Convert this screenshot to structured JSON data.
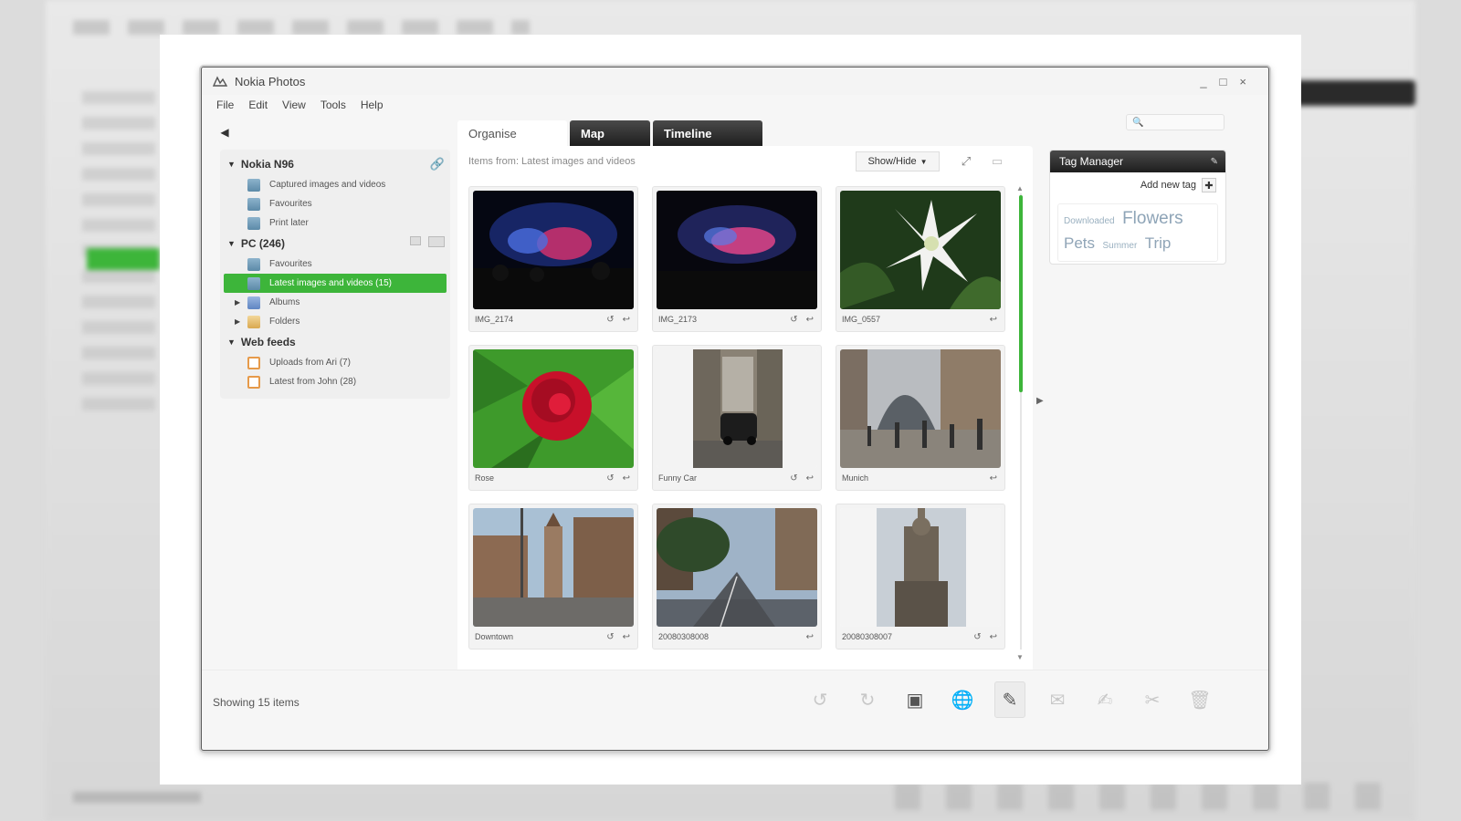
{
  "window": {
    "title": "Nokia Photos",
    "controls": [
      "_",
      "□",
      "×"
    ]
  },
  "menu": [
    "File",
    "Edit",
    "View",
    "Tools",
    "Help"
  ],
  "sidebar": {
    "sections": [
      {
        "label": "Nokia N96",
        "items": [
          {
            "label": "Captured images and videos",
            "icon": "photo-album-icon"
          },
          {
            "label": "Favourites",
            "icon": "photo-album-icon"
          },
          {
            "label": "Print later",
            "icon": "photo-album-icon"
          }
        ]
      },
      {
        "label": "PC (246)",
        "items": [
          {
            "label": "Favourites",
            "icon": "photo-album-icon"
          },
          {
            "label": "Latest images and videos (15)",
            "icon": "photo-album-icon",
            "selected": true
          },
          {
            "label": "Albums",
            "icon": "album-icon",
            "expandable": true
          },
          {
            "label": "Folders",
            "icon": "folder-icon",
            "expandable": true
          }
        ]
      },
      {
        "label": "Web feeds",
        "items": [
          {
            "label": "Uploads from Ari (7)",
            "icon": "feed-icon"
          },
          {
            "label": "Latest from John (28)",
            "icon": "feed-icon"
          }
        ]
      }
    ]
  },
  "tabs": [
    {
      "label": "Organise",
      "active": true
    },
    {
      "label": "Map",
      "active": false
    },
    {
      "label": "Timeline",
      "active": false
    }
  ],
  "content": {
    "header": "Items from: Latest images and videos",
    "show_hide_label": "Show/Hide",
    "items": [
      {
        "caption": "IMG_2174",
        "scene": "concert"
      },
      {
        "caption": "IMG_2173",
        "scene": "concert"
      },
      {
        "caption": "IMG_0557",
        "scene": "lily"
      },
      {
        "caption": "Rose",
        "scene": "rose"
      },
      {
        "caption": "Funny Car",
        "scene": "car"
      },
      {
        "caption": "Munich",
        "scene": "plaza"
      },
      {
        "caption": "Downtown",
        "scene": "downtown"
      },
      {
        "caption": "20080308008",
        "scene": "street"
      },
      {
        "caption": "20080308007",
        "scene": "statue"
      }
    ]
  },
  "tag_manager": {
    "title": "Tag Manager",
    "add_label": "Add new tag",
    "tags": [
      {
        "label": "Downloaded",
        "size": "small"
      },
      {
        "label": "Flowers",
        "size": "big"
      },
      {
        "label": "Pets",
        "size": "mid"
      },
      {
        "label": "Summer",
        "size": "small"
      },
      {
        "label": "Trip",
        "size": "mid"
      }
    ]
  },
  "status": {
    "text": "Showing 15 items"
  },
  "accent_color": "#3db53a"
}
